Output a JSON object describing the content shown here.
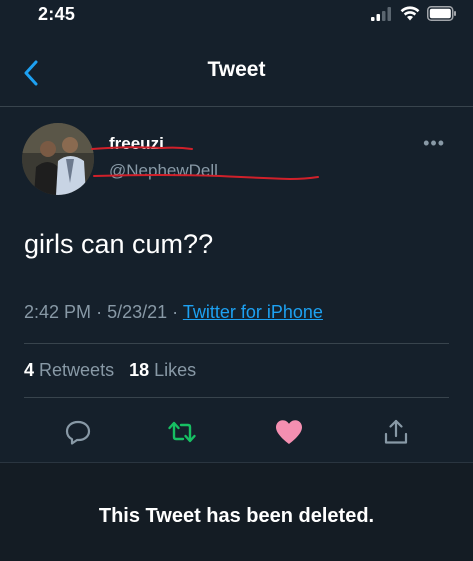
{
  "status_bar": {
    "time": "2:45"
  },
  "nav": {
    "title": "Tweet"
  },
  "tweet": {
    "author_name": "freeuzi",
    "author_handle": "@NephewDell",
    "text": "girls can cum??",
    "time": "2:42 PM",
    "date": "5/23/21",
    "separator": "·",
    "source": "Twitter for iPhone",
    "retweets_count": "4",
    "retweets_label": "Retweets",
    "likes_count": "18",
    "likes_label": "Likes",
    "more_label": "•••"
  },
  "banner": {
    "text": "This Tweet has been deleted."
  },
  "colors": {
    "background": "#15202b",
    "accent": "#1da1f2",
    "secondary_text": "#8899a6",
    "retweet_green": "#17bf63",
    "like_pink": "#f48fb1",
    "redaction_red": "#d0202a"
  }
}
